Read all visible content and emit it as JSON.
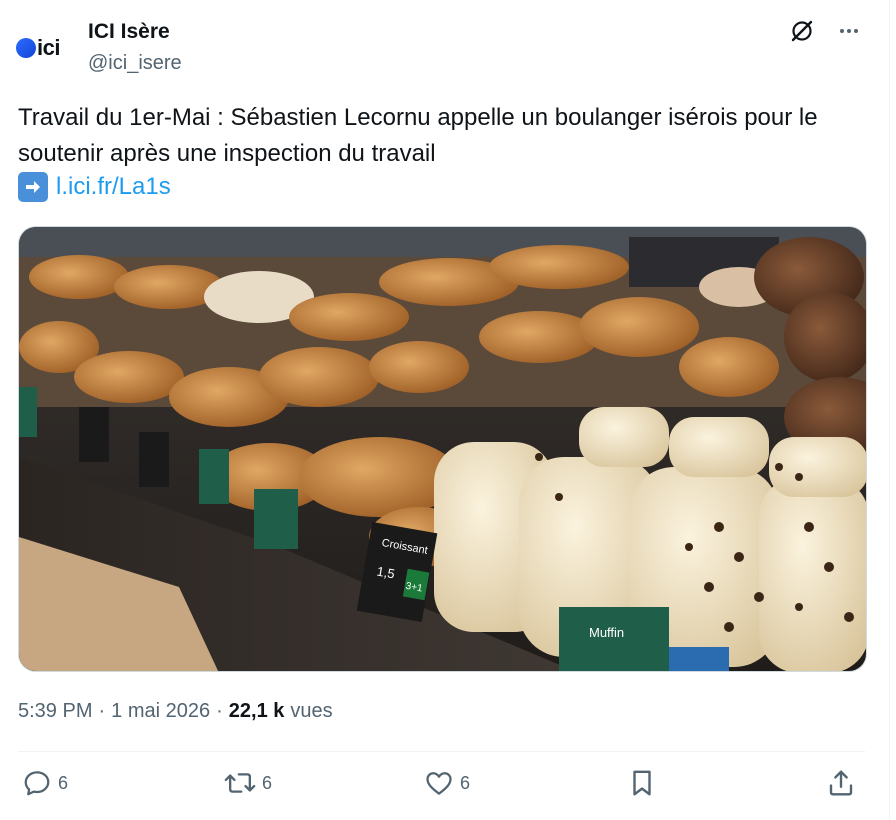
{
  "header": {
    "avatar_text": "ici",
    "display_name": "ICI Isère",
    "handle": "@ici_isere",
    "icons": [
      "grok-icon",
      "more-icon"
    ]
  },
  "tweet": {
    "text": "Travail du 1er-Mai : Sébastien Lecornu appelle un boulanger isérois pour le soutenir après une inspection du travail",
    "link_icon": "right-arrow-emoji",
    "link_text": "l.ici.fr/La1s"
  },
  "media": {
    "alt": "photo",
    "label_texts": [
      "Croissant",
      "Muffin",
      "3+1",
      "1,5"
    ]
  },
  "meta": {
    "time": "5:39 PM",
    "separator1": "·",
    "date": "1 mai 2026",
    "separator2": "·",
    "views_count": "22,1 k",
    "views_label": "vues"
  },
  "actions": {
    "reply_count": "6",
    "retweet_count": "6",
    "like_count": "6",
    "icons": [
      "reply-icon",
      "retweet-icon",
      "like-icon",
      "bookmark-icon",
      "share-icon"
    ]
  },
  "colors": {
    "link": "#1d9bf0",
    "secondary_text": "#536471",
    "primary_text": "#0f1419",
    "brand_blue": "#2b6bff"
  }
}
